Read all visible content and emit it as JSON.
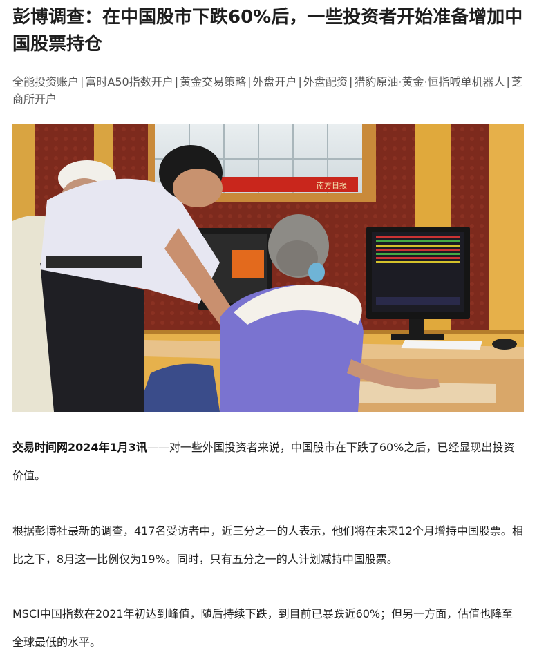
{
  "article": {
    "title": "彭博调查：在中国股市下跌60%后，一些投资者开始准备增加中国股票持仓",
    "links": [
      "全能投资账户",
      "富时A50指数开户",
      "黄金交易策略",
      "外盘开户",
      "外盘配资",
      "猎豹原油·黄金·恒指喊单机器人",
      "芝商所开户"
    ],
    "separator": "|",
    "photo": {
      "sign_text": "南方日报"
    },
    "paragraphs": [
      {
        "lead": "交易时间网2024年1月3讯",
        "text": "——对一些外国投资者来说，中国股市在下跌了60%之后，已经显现出投资价值。"
      },
      {
        "lead": "",
        "text": "根据彭博社最新的调查，417名受访者中，近三分之一的人表示，他们将在未来12个月增持中国股票。相比之下，8月这一比例仅为19%。同时，只有五分之一的人计划减持中国股票。"
      },
      {
        "lead": "",
        "text": "MSCI中国指数在2021年初达到峰值，随后持续下跌，到目前已暴跌近60%；但另一方面，估值也降至全球最低的水平。"
      }
    ]
  }
}
